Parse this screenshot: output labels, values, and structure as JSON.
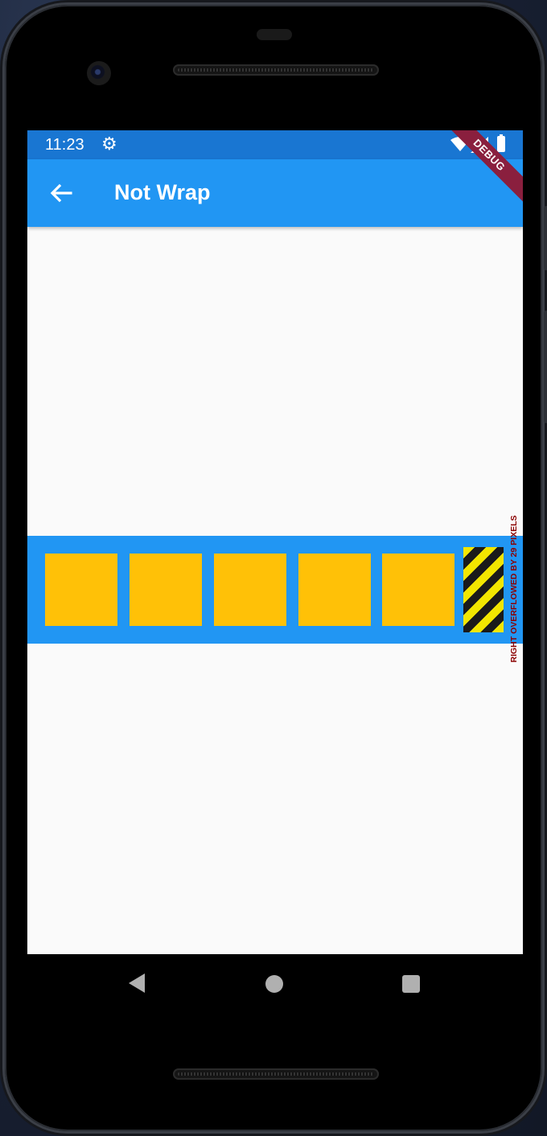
{
  "status_bar": {
    "time": "11:23",
    "icons": [
      "gear-icon",
      "wifi-icon",
      "signal-icon",
      "battery-icon"
    ]
  },
  "app_bar": {
    "title": "Not Wrap",
    "back_icon": "arrow-left-icon",
    "banner": "DEBUG"
  },
  "content": {
    "row_color": "#2196f3",
    "box_color": "#ffc107",
    "box_count": 5,
    "overflow_message": "RIGHT OVERFLOWED BY 29 PIXELS"
  },
  "nav_bar": {
    "buttons": [
      "back-triangle-icon",
      "home-circle-icon",
      "recents-square-icon"
    ]
  },
  "colors": {
    "status_bar": "#1976d2",
    "app_bar": "#2196f3",
    "background": "#fafafa",
    "debug_banner": "#8a1f3e"
  }
}
